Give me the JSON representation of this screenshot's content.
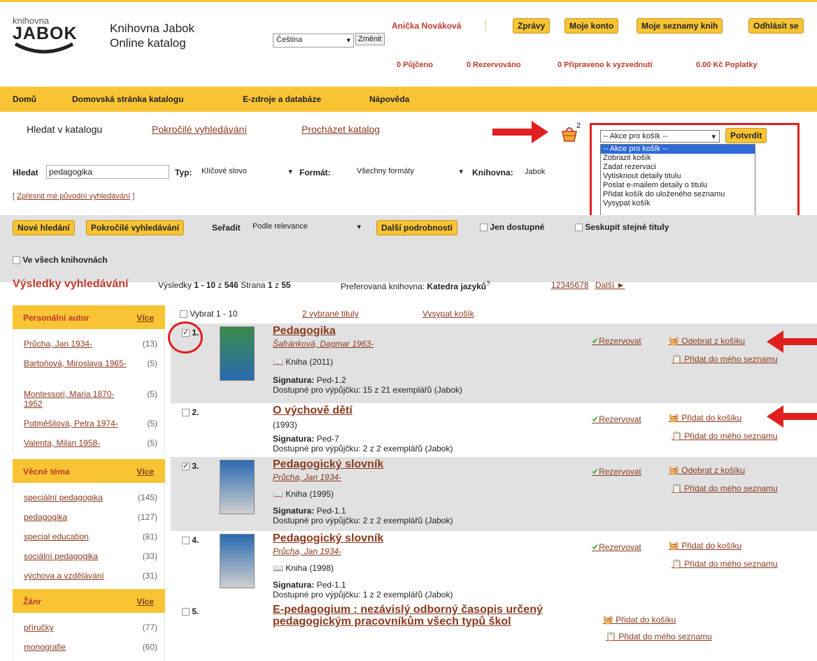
{
  "header": {
    "logo_small": "knihovna",
    "logo_big": "JABOK",
    "site_line1": "Knihovna Jabok",
    "site_line2": "Online katalog",
    "lang_value": "Čeština",
    "lang_btn": "Změnit",
    "user": "Anička Nováková",
    "btn_messages": "Zprávy",
    "btn_account": "Moje konto",
    "btn_lists": "Moje seznamy knih",
    "btn_logout": "Odhlásit se",
    "stat_borrowed": "0 Půjčeno",
    "stat_reserved": "0 Rezervováno",
    "stat_ready": "0 Připraveno k vyzvednutí",
    "stat_fees": "0.00 Kč Poplatky"
  },
  "nav": {
    "home": "Domů",
    "catalog_home": "Domovská stránka katalogu",
    "eres": "E-zdroje a databáze",
    "help": "Nápověda"
  },
  "search_tabs": {
    "search": "Hledat v katalogu",
    "advanced": "Pokročilé vyhledávání",
    "browse": "Procházet katalog"
  },
  "cart": {
    "count": "2",
    "action_value": "-- Akce pro košík --",
    "confirm": "Potvrdit",
    "options": [
      "-- Akce pro košík --",
      "Zobrazit košík",
      "Zadat rezervaci",
      "Vytisknout detaily titulu",
      "Poslat e-mailem detaily o titulu",
      "Přidat košík do uloženého seznamu",
      "Vysypat košík"
    ]
  },
  "searchbar": {
    "query_label": "Hledat",
    "query_value": "pedagogika",
    "type_label": "Typ:",
    "type_value": "Klíčové slovo",
    "format_label": "Formát:",
    "format_value": "Všechny formáty",
    "library_label": "Knihovna:",
    "library_value": "Jabok",
    "refine": "Zpřesnit mé původní vyhledávání"
  },
  "toolbar": {
    "new_search": "Nové hledání",
    "advanced": "Pokročilé vyhledávání",
    "sort_label": "Seřadit",
    "sort_value": "Podle relevance",
    "more_details": "Další podrobnosti",
    "only_available": "Jen dostupné",
    "group_same": "Seskupit stejné tituly",
    "all_libraries": "Ve všech knihovnách"
  },
  "results_header": {
    "title": "Výsledky vyhledávání",
    "summary_prefix": "Výsledky",
    "range": "1 - 10",
    "of": "z",
    "total": "546",
    "page_label": "Strana",
    "page": "1",
    "pages": "55",
    "preferred_label": "Preferovaná knihovna:",
    "preferred": "Katedra jazyků",
    "sup": "?",
    "pagination": [
      "1",
      "2",
      "3",
      "4",
      "5",
      "6",
      "7",
      "8"
    ],
    "next": "Další ►"
  },
  "list_tools": {
    "select": "Vybrat 1 - 10",
    "selected": "2 vybrané tituly",
    "empty": "Vysypat košík"
  },
  "facets": [
    {
      "title": "Personální autor",
      "more": "Více",
      "items": [
        {
          "name": "Průcha, Jan 1934-",
          "count": "(13)"
        },
        {
          "name": "Bartoňová, Miroslava 1965-",
          "count": "(5)"
        },
        {
          "name": "Montessori, Maria 1870-1952",
          "count": "(5)"
        },
        {
          "name": "Potměšilová, Petra 1974-",
          "count": "(5)"
        },
        {
          "name": "Valenta, Milan 1958-",
          "count": "(5)"
        }
      ]
    },
    {
      "title": "Věcné téma",
      "more": "Více",
      "items": [
        {
          "name": "speciální pedagogika",
          "count": "(145)"
        },
        {
          "name": "pedagogika",
          "count": "(127)"
        },
        {
          "name": "special education",
          "count": "(81)"
        },
        {
          "name": "sociální pedagogika",
          "count": "(33)"
        },
        {
          "name": "výchova a vzdělávání",
          "count": "(31)"
        }
      ]
    },
    {
      "title": "Žánr",
      "more": "Více",
      "items": [
        {
          "name": "příručky",
          "count": "(77)"
        },
        {
          "name": "monografie",
          "count": "(60)"
        }
      ]
    }
  ],
  "results": [
    {
      "num": "1.",
      "checked": true,
      "title": "Pedagogika",
      "author": "Šafránková, Dagmar 1963-",
      "format": "Kniha (2011)",
      "sig_label": "Signatura:",
      "sig": "Ped-1.2",
      "avail": "Dostupné pro výpůjčku: 15 z 21 exemplářů (Jabok)",
      "reserve": "Rezervovat",
      "cart": "Odebrat z košíku",
      "list": "Přidat do mého seznamu"
    },
    {
      "num": "2.",
      "checked": false,
      "title": "O výchově dětí",
      "author": "",
      "format": "(1993)",
      "sig_label": "Signatura:",
      "sig": "Ped-7",
      "avail": "Dostupné pro výpůjčku: 2 z 2 exemplářů (Jabok)",
      "reserve": "Rezervovat",
      "cart": "Přidat do košíku",
      "list": "Přidat do mého seznamu"
    },
    {
      "num": "3.",
      "checked": true,
      "title": "Pedagogický slovník",
      "author": "Průcha, Jan 1934-",
      "format": "Kniha (1995)",
      "sig_label": "Signatura:",
      "sig": "Ped-1.1",
      "avail": "Dostupné pro výpůjčku: 2 z 2 exemplářů (Jabok)",
      "reserve": "Rezervovat",
      "cart": "Odebrat z košíku",
      "list": "Přidat do mého seznamu"
    },
    {
      "num": "4.",
      "checked": false,
      "title": "Pedagogický slovník",
      "author": "Průcha, Jan 1934-",
      "format": "Kniha (1998)",
      "sig_label": "Signatura:",
      "sig": "Ped-1.1",
      "avail": "Dostupné pro výpůjčku: 1 z 2 exemplářů (Jabok)",
      "reserve": "Rezervovat",
      "cart": "Přidat do košíku",
      "list": "Přidat do mého seznamu"
    },
    {
      "num": "5.",
      "checked": false,
      "title": "E-pedagogium : nezávislý odborný časopis určený pedagogickým pracovníkům všech typů škol",
      "author": "",
      "format": "",
      "sig_label": "",
      "sig": "",
      "avail": "",
      "reserve": "",
      "cart": "Přidat do košíku",
      "list": "Přidat do mého seznamu"
    }
  ]
}
